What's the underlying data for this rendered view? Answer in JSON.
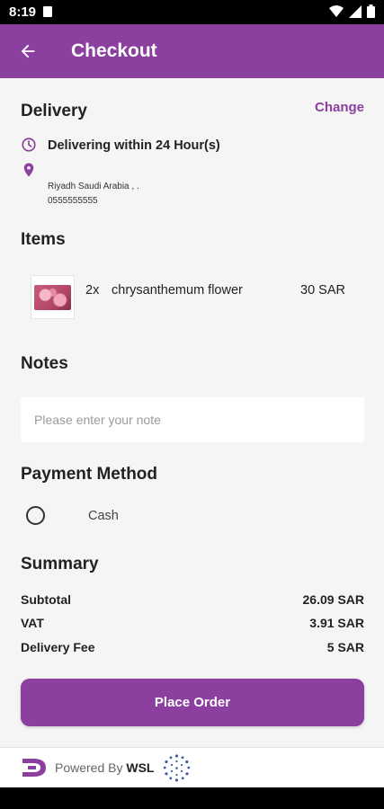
{
  "status_bar": {
    "time": "8:19"
  },
  "app_bar": {
    "title": "Checkout"
  },
  "delivery": {
    "title": "Delivery",
    "change_label": "Change",
    "time_text": "Delivering within 24 Hour(s)",
    "address_line": "Riyadh Saudi Arabia , .",
    "phone": "0555555555"
  },
  "items": {
    "title": "Items",
    "list": [
      {
        "qty": "2x",
        "name": "chrysanthemum flower",
        "price": "30 SAR"
      }
    ]
  },
  "notes": {
    "title": "Notes",
    "placeholder": "Please enter your note",
    "value": ""
  },
  "payment": {
    "title": "Payment Method",
    "options": [
      {
        "label": "Cash",
        "selected": false
      }
    ]
  },
  "summary": {
    "title": "Summary",
    "rows": [
      {
        "label": "Subtotal",
        "value": "26.09 SAR"
      },
      {
        "label": "VAT",
        "value": "3.91 SAR"
      },
      {
        "label": "Delivery Fee",
        "value": "5 SAR"
      }
    ]
  },
  "actions": {
    "place_order": "Place Order"
  },
  "footer": {
    "powered_by": "Powered By",
    "brand": "WSL"
  },
  "colors": {
    "accent": "#8b3f9f",
    "background": "#f5f5f5"
  }
}
